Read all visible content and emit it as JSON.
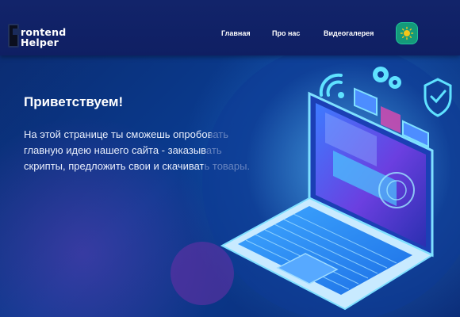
{
  "header": {
    "logo_line1": "rontend",
    "logo_line2": "Helper",
    "nav": [
      {
        "label": "Главная"
      },
      {
        "label": "Про нас"
      },
      {
        "label": "Видеогалерея"
      }
    ],
    "theme_toggle_icon": "sun-icon",
    "theme_toggle_color": "#149a7a"
  },
  "hero": {
    "title": "Приветствуем!",
    "text": "На этой странице ты сможешь опробовать главную идею нашего сайта - заказывать скрипты, предложить свои и скачивать товары."
  },
  "colors": {
    "header_bg": "#12246a",
    "page_bg": "#0a3b8f",
    "accent": "#2fd7ff"
  },
  "illustration": {
    "icons": [
      "wifi-icon",
      "gear-icon",
      "shield-check-icon",
      "laptop-icon"
    ]
  }
}
